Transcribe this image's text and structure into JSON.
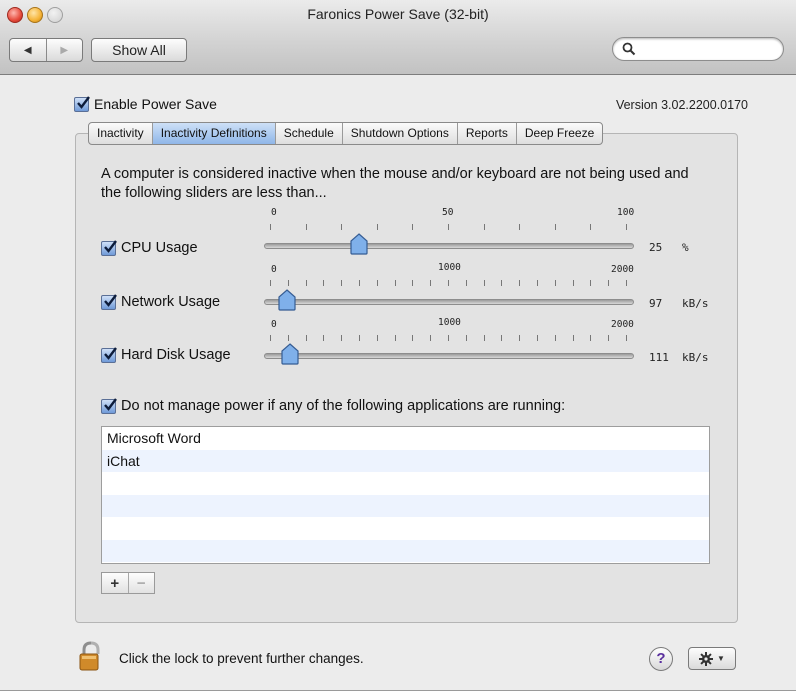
{
  "window": {
    "title": "Faronics Power Save (32-bit)"
  },
  "toolbar": {
    "back_icon": "triangle-left-icon",
    "forward_icon": "triangle-right-icon",
    "show_all_label": "Show All",
    "search_placeholder": "",
    "search_value": ""
  },
  "header": {
    "enable_label": "Enable Power Save",
    "enable_checked": true,
    "version": "Version 3.02.2200.0170"
  },
  "tabs": [
    {
      "label": "Inactivity",
      "active": false
    },
    {
      "label": "Inactivity Definitions",
      "active": true
    },
    {
      "label": "Schedule",
      "active": false
    },
    {
      "label": "Shutdown Options",
      "active": false
    },
    {
      "label": "Reports",
      "active": false
    },
    {
      "label": "Deep Freeze",
      "active": false
    }
  ],
  "definitions": {
    "intro": "A computer is considered inactive when the mouse and/or keyboard are not being used and the following sliders are less than...",
    "sliders": [
      {
        "label": "CPU Usage",
        "checked": true,
        "min": 0,
        "mid": 50,
        "max": 100,
        "value": 25,
        "value_text": "25",
        "unit": "%",
        "ticks": 11
      },
      {
        "label": "Network Usage",
        "checked": true,
        "min": 0,
        "mid": 1000,
        "max": 2000,
        "value": 97,
        "value_text": "97",
        "unit": "kB/s",
        "ticks": 21
      },
      {
        "label": "Hard Disk Usage",
        "checked": true,
        "min": 0,
        "mid": 1000,
        "max": 2000,
        "value": 111,
        "value_text": "111",
        "unit": "kB/s",
        "ticks": 21
      }
    ],
    "manage_label": "Do not manage power if any of the following applications are running:",
    "manage_checked": true,
    "apps": [
      "Microsoft Word",
      "iChat",
      "",
      "",
      "",
      ""
    ],
    "add_label": "+",
    "remove_label": "−"
  },
  "footer": {
    "lock_text": "Click the lock to prevent further changes.",
    "help_label": "?",
    "gear_icon": "gear-icon"
  },
  "colors": {
    "active_tab": "#8fb6e8",
    "stripe": "#edf3fe",
    "help_text": "#5a2f9e"
  }
}
